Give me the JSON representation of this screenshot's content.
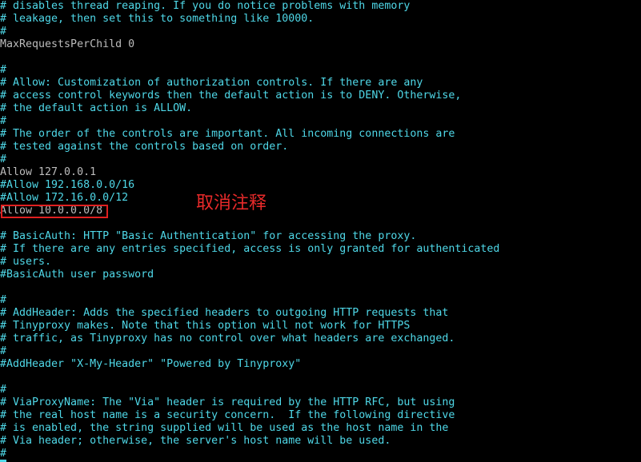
{
  "terminal": {
    "lines": [
      {
        "text": "# disables thread reaping. If you do notice problems with memory",
        "kind": "comment"
      },
      {
        "text": "# leakage, then set this to something like 10000.",
        "kind": "comment"
      },
      {
        "text": "#",
        "kind": "comment"
      },
      {
        "text": "MaxRequestsPerChild 0",
        "kind": "directive"
      },
      {
        "text": "",
        "kind": "blank"
      },
      {
        "text": "#",
        "kind": "comment"
      },
      {
        "text": "# Allow: Customization of authorization controls. If there are any",
        "kind": "comment"
      },
      {
        "text": "# access control keywords then the default action is to DENY. Otherwise,",
        "kind": "comment"
      },
      {
        "text": "# the default action is ALLOW.",
        "kind": "comment"
      },
      {
        "text": "#",
        "kind": "comment"
      },
      {
        "text": "# The order of the controls are important. All incoming connections are",
        "kind": "comment"
      },
      {
        "text": "# tested against the controls based on order.",
        "kind": "comment"
      },
      {
        "text": "#",
        "kind": "comment"
      },
      {
        "text": "Allow 127.0.0.1",
        "kind": "directive"
      },
      {
        "text": "#Allow 192.168.0.0/16",
        "kind": "comment"
      },
      {
        "text": "#Allow 172.16.0.0/12",
        "kind": "comment"
      },
      {
        "text": "Allow 10.0.0.0/8",
        "kind": "directive"
      },
      {
        "text": "",
        "kind": "blank"
      },
      {
        "text": "# BasicAuth: HTTP \"Basic Authentication\" for accessing the proxy.",
        "kind": "comment"
      },
      {
        "text": "# If there are any entries specified, access is only granted for authenticated",
        "kind": "comment"
      },
      {
        "text": "# users.",
        "kind": "comment"
      },
      {
        "text": "#BasicAuth user password",
        "kind": "comment"
      },
      {
        "text": "",
        "kind": "blank"
      },
      {
        "text": "#",
        "kind": "comment"
      },
      {
        "text": "# AddHeader: Adds the specified headers to outgoing HTTP requests that",
        "kind": "comment"
      },
      {
        "text": "# Tinyproxy makes. Note that this option will not work for HTTPS",
        "kind": "comment"
      },
      {
        "text": "# traffic, as Tinyproxy has no control over what headers are exchanged.",
        "kind": "comment"
      },
      {
        "text": "#",
        "kind": "comment"
      },
      {
        "text": "#AddHeader \"X-My-Header\" \"Powered by Tinyproxy\"",
        "kind": "comment"
      },
      {
        "text": "",
        "kind": "blank"
      },
      {
        "text": "#",
        "kind": "comment"
      },
      {
        "text": "# ViaProxyName: The \"Via\" header is required by the HTTP RFC, but using",
        "kind": "comment"
      },
      {
        "text": "# the real host name is a security concern.  If the following directive",
        "kind": "comment"
      },
      {
        "text": "# is enabled, the string supplied will be used as the host name in the",
        "kind": "comment"
      },
      {
        "text": "# Via header; otherwise, the server's host name will be used.",
        "kind": "comment"
      },
      {
        "text": "#",
        "kind": "comment"
      }
    ]
  },
  "annotation": {
    "text": "取消注释",
    "color": "#e82a2a"
  },
  "colors": {
    "background": "#000000",
    "comment": "#4fd8e8",
    "directive": "#bcbcbc",
    "highlight": "#e02020"
  }
}
